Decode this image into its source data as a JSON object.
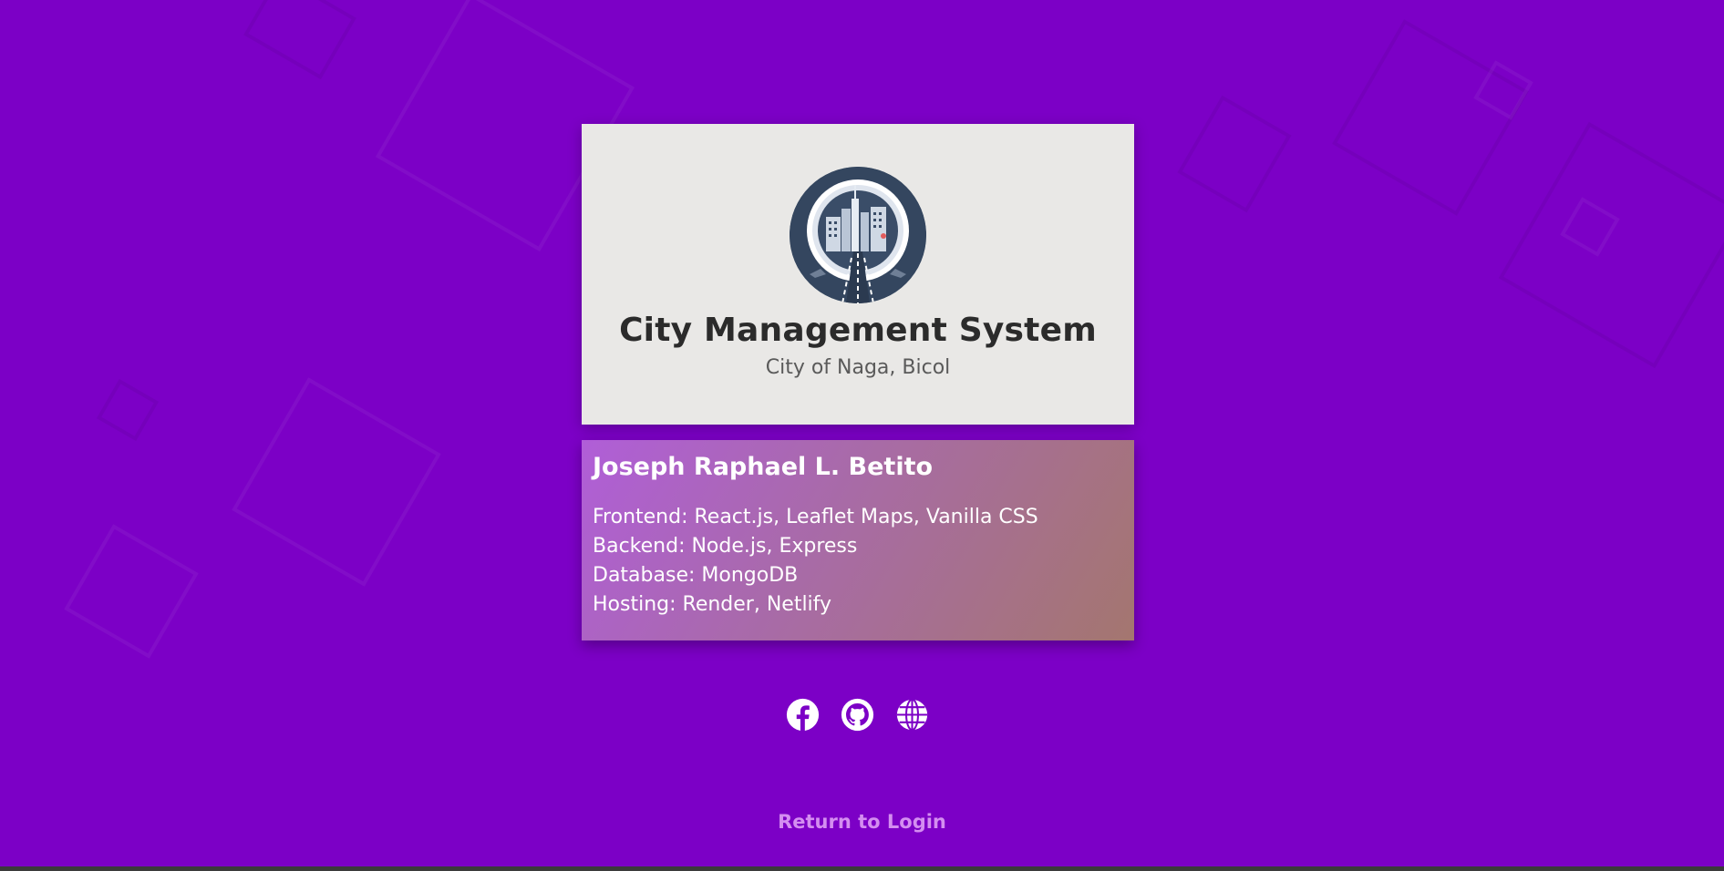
{
  "colors": {
    "background": "#7c00c6",
    "card_top": "#e9e8e6",
    "title_text": "#2b2b2b",
    "link_text": "#d48ef0"
  },
  "header": {
    "title": "City Management System",
    "subtitle": "City of Naga, Bicol",
    "logo_icon": "city-skyline-logo"
  },
  "developer": {
    "name": "Joseph Raphael L. Betito",
    "stack": [
      "Frontend: React.js, Leaflet Maps, Vanilla CSS",
      "Backend: Node.js, Express",
      "Database: MongoDB",
      "Hosting: Render, Netlify"
    ]
  },
  "social_links": [
    {
      "icon": "facebook-icon"
    },
    {
      "icon": "github-icon"
    },
    {
      "icon": "globe-icon"
    }
  ],
  "footer": {
    "return_label": "Return to Login"
  }
}
